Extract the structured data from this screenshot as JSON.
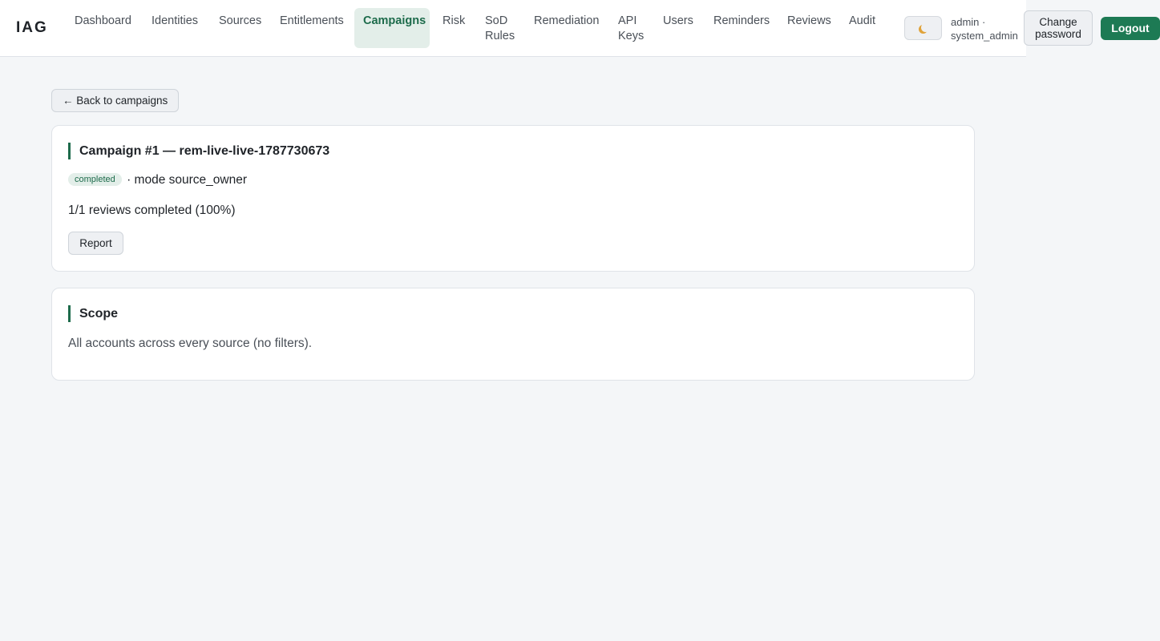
{
  "app": {
    "brand": "IAG",
    "nav": [
      {
        "label": "Dashboard",
        "active": false
      },
      {
        "label": "Identities",
        "active": false
      },
      {
        "label": "Sources",
        "active": false
      },
      {
        "label": "Entitlements",
        "active": false
      },
      {
        "label": "Campaigns",
        "active": true
      },
      {
        "label": "Risk",
        "active": false
      },
      {
        "label": "SoD\nRules",
        "active": false
      },
      {
        "label": "Remediation",
        "active": false
      },
      {
        "label": "API\nKeys",
        "active": false
      },
      {
        "label": "Users",
        "active": false
      },
      {
        "label": "Reminders",
        "active": false
      },
      {
        "label": "Reviews",
        "active": false
      },
      {
        "label": "Audit",
        "active": false
      }
    ],
    "theme_toggle_icon": "moon-icon",
    "user": {
      "name": "admin ·",
      "role": "system_admin"
    },
    "change_password_label": "Change\npassword",
    "logout_label": "Logout"
  },
  "back_label": "← Back to campaigns",
  "campaign": {
    "title": "Campaign #1 — rem-live-live-1787730673",
    "status": "completed",
    "mode_text": "· mode source_owner",
    "progress_text": "1/1 reviews completed (100%)",
    "progress_fraction": 1.0,
    "report_label": "Report"
  },
  "scope": {
    "title": "Scope",
    "text": "All accounts across every source (no filters)."
  },
  "colors": {
    "accent": "#1d6b4b",
    "logout_bg": "#1d7a54",
    "page_bg": "#f4f6f8"
  }
}
